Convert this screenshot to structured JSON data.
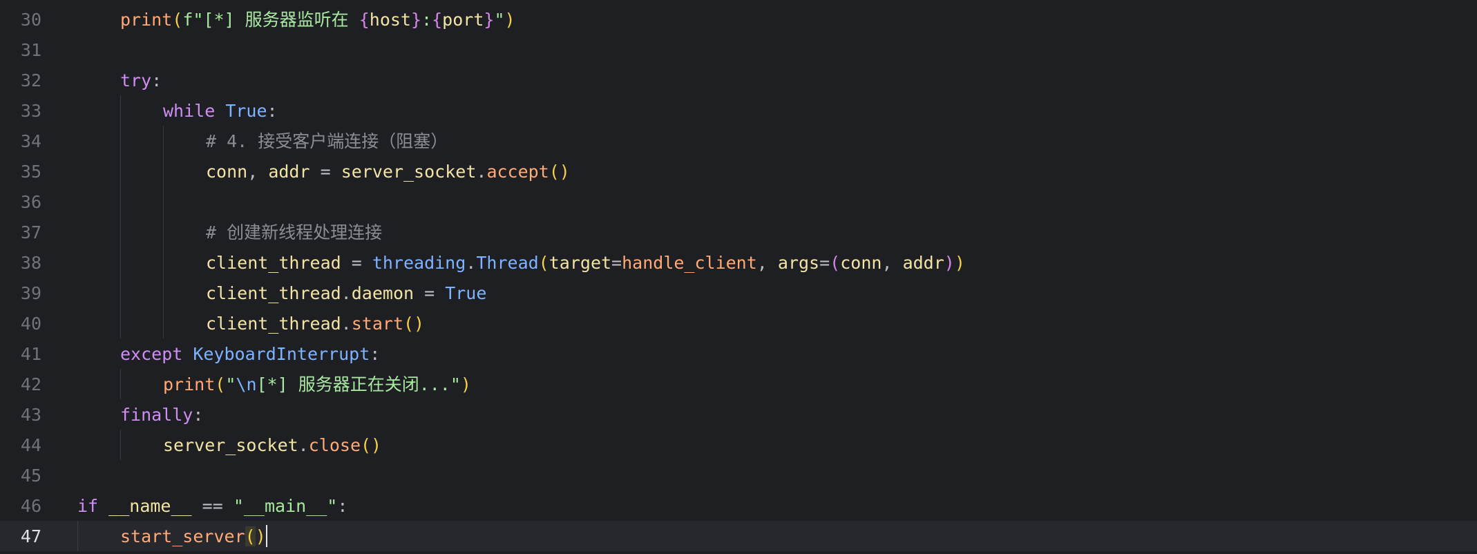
{
  "editor": {
    "current_line": 47,
    "lines": [
      {
        "num": "30",
        "tokens": [
          {
            "t": "print",
            "c": "fn"
          },
          {
            "t": "(",
            "c": "brk"
          },
          {
            "t": "f\"[*] 服务器监听在 ",
            "c": "str"
          },
          {
            "t": "{",
            "c": "br2"
          },
          {
            "t": "host",
            "c": "var"
          },
          {
            "t": "}",
            "c": "br2"
          },
          {
            "t": ":",
            "c": "str"
          },
          {
            "t": "{",
            "c": "br2"
          },
          {
            "t": "port",
            "c": "var"
          },
          {
            "t": "}",
            "c": "br2"
          },
          {
            "t": "\"",
            "c": "str"
          },
          {
            "t": ")",
            "c": "brk"
          }
        ]
      },
      {
        "num": "31",
        "tokens": []
      },
      {
        "num": "32",
        "tokens": [
          {
            "t": "try",
            "c": "kw"
          },
          {
            "t": ":",
            "c": "op"
          }
        ]
      },
      {
        "num": "33",
        "tokens": [
          {
            "t": "while",
            "c": "kw"
          },
          {
            "t": " ",
            "c": "op"
          },
          {
            "t": "True",
            "c": "cls"
          },
          {
            "t": ":",
            "c": "op"
          }
        ]
      },
      {
        "num": "34",
        "tokens": [
          {
            "t": "# 4. 接受客户端连接（阻塞）",
            "c": "cmt"
          }
        ]
      },
      {
        "num": "35",
        "tokens": [
          {
            "t": "conn",
            "c": "var"
          },
          {
            "t": ", ",
            "c": "op"
          },
          {
            "t": "addr",
            "c": "var"
          },
          {
            "t": " = ",
            "c": "op"
          },
          {
            "t": "server_socket",
            "c": "var"
          },
          {
            "t": ".",
            "c": "op"
          },
          {
            "t": "accept",
            "c": "fn"
          },
          {
            "t": "()",
            "c": "brk"
          }
        ]
      },
      {
        "num": "36",
        "tokens": []
      },
      {
        "num": "37",
        "tokens": [
          {
            "t": "# 创建新线程处理连接",
            "c": "cmt"
          }
        ]
      },
      {
        "num": "38",
        "tokens": [
          {
            "t": "client_thread",
            "c": "var"
          },
          {
            "t": " = ",
            "c": "op"
          },
          {
            "t": "threading",
            "c": "cls"
          },
          {
            "t": ".",
            "c": "op"
          },
          {
            "t": "Thread",
            "c": "cls"
          },
          {
            "t": "(",
            "c": "brk"
          },
          {
            "t": "target",
            "c": "var"
          },
          {
            "t": "=",
            "c": "op"
          },
          {
            "t": "handle_client",
            "c": "fn"
          },
          {
            "t": ", ",
            "c": "op"
          },
          {
            "t": "args",
            "c": "var"
          },
          {
            "t": "=",
            "c": "op"
          },
          {
            "t": "(",
            "c": "br2"
          },
          {
            "t": "conn",
            "c": "var"
          },
          {
            "t": ", ",
            "c": "op"
          },
          {
            "t": "addr",
            "c": "var"
          },
          {
            "t": ")",
            "c": "br2"
          },
          {
            "t": ")",
            "c": "brk"
          }
        ]
      },
      {
        "num": "39",
        "tokens": [
          {
            "t": "client_thread",
            "c": "var"
          },
          {
            "t": ".",
            "c": "op"
          },
          {
            "t": "daemon",
            "c": "var"
          },
          {
            "t": " = ",
            "c": "op"
          },
          {
            "t": "True",
            "c": "cls"
          }
        ]
      },
      {
        "num": "40",
        "tokens": [
          {
            "t": "client_thread",
            "c": "var"
          },
          {
            "t": ".",
            "c": "op"
          },
          {
            "t": "start",
            "c": "fn"
          },
          {
            "t": "()",
            "c": "brk"
          }
        ]
      },
      {
        "num": "41",
        "tokens": [
          {
            "t": "except",
            "c": "kw"
          },
          {
            "t": " ",
            "c": "op"
          },
          {
            "t": "KeyboardInterrupt",
            "c": "cls"
          },
          {
            "t": ":",
            "c": "op"
          }
        ]
      },
      {
        "num": "42",
        "tokens": [
          {
            "t": "print",
            "c": "fn"
          },
          {
            "t": "(",
            "c": "brk"
          },
          {
            "t": "\"",
            "c": "str"
          },
          {
            "t": "\\n",
            "c": "cls"
          },
          {
            "t": "[*] 服务器正在关闭...\"",
            "c": "str"
          },
          {
            "t": ")",
            "c": "brk"
          }
        ]
      },
      {
        "num": "43",
        "tokens": [
          {
            "t": "finally",
            "c": "kw"
          },
          {
            "t": ":",
            "c": "op"
          }
        ]
      },
      {
        "num": "44",
        "tokens": [
          {
            "t": "server_socket",
            "c": "var"
          },
          {
            "t": ".",
            "c": "op"
          },
          {
            "t": "close",
            "c": "fn"
          },
          {
            "t": "()",
            "c": "brk"
          }
        ]
      },
      {
        "num": "45",
        "tokens": []
      },
      {
        "num": "46",
        "tokens": [
          {
            "t": "if",
            "c": "kw"
          },
          {
            "t": " ",
            "c": "op"
          },
          {
            "t": "__name__",
            "c": "var"
          },
          {
            "t": " == ",
            "c": "op"
          },
          {
            "t": "\"__main__\"",
            "c": "str"
          },
          {
            "t": ":",
            "c": "op"
          }
        ]
      },
      {
        "num": "47",
        "tokens": [
          {
            "t": "start_server",
            "c": "fn"
          },
          {
            "t": "(",
            "c": "brk hl"
          },
          {
            "t": ")",
            "c": "brk"
          }
        ]
      }
    ]
  }
}
